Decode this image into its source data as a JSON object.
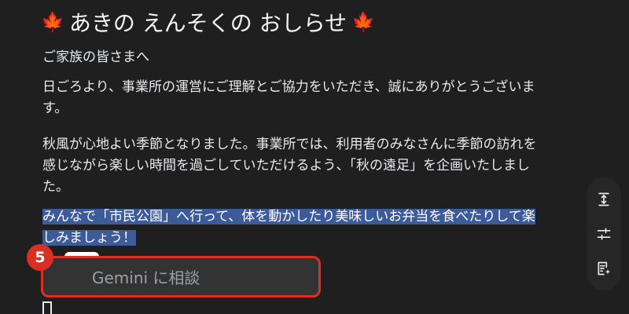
{
  "document": {
    "title_text": "あきの えんそくの おしらせ",
    "title_leaf_icon": "maple-leaf-icon",
    "greeting": "ご家族の皆さまへ",
    "intro": "日ごろより、事業所の運営にご理解とご協力をいただき、誠にありがとうございます。",
    "plan": "秋風が心地よい季節となりました。事業所では、利用者のみなさんに季節の訪れを感じながら楽しい時間を過ごしていただけるよう、「秋の遠足」を企画いたしました。",
    "highlighted": "みんなで「市民公園」へ行って、体を動かしたり美味しいお弁当を食べたりして楽しみましょう！"
  },
  "step_badge": {
    "number": "5",
    "color": "#d93025"
  },
  "gemini_prompt": {
    "label": "Gemini に相談"
  },
  "side_toolbar": {
    "icons": [
      "expand-vertical-icon",
      "tune-sliders-icon",
      "add-notes-icon"
    ]
  },
  "colors": {
    "background": "#1f1f1f",
    "highlight": "#3d5a99",
    "accent_red": "#d93025"
  }
}
